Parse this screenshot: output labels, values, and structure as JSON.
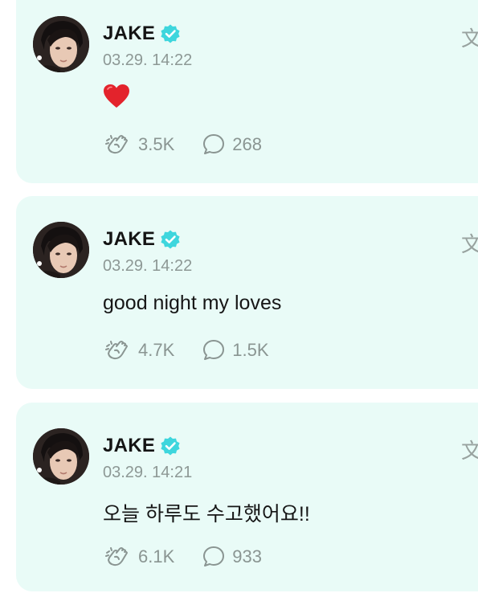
{
  "posts": [
    {
      "author": "JAKE",
      "timestamp": "03.29. 14:22",
      "content_type": "emoji",
      "content": "",
      "content_emoji": "red-heart",
      "likes": "3.5K",
      "comments": "268",
      "translate_glyph": "文"
    },
    {
      "author": "JAKE",
      "timestamp": "03.29. 14:22",
      "content_type": "text",
      "content": "good night my loves",
      "likes": "4.7K",
      "comments": "1.5K",
      "translate_glyph": "文"
    },
    {
      "author": "JAKE",
      "timestamp": "03.29. 14:21",
      "content_type": "text",
      "content": "오늘 하루도 수고했어요!!",
      "likes": "6.1K",
      "comments": "933",
      "translate_glyph": "文"
    }
  ],
  "colors": {
    "card_bg": "#e9fbf7",
    "verified": "#3ed6dd",
    "meta_text": "#8d9895",
    "heart": "#e3232c"
  },
  "icons": {
    "verified": "verified-badge-icon",
    "like": "clapping-hand-icon",
    "comment": "speech-bubble-icon",
    "translate": "translate-icon"
  }
}
